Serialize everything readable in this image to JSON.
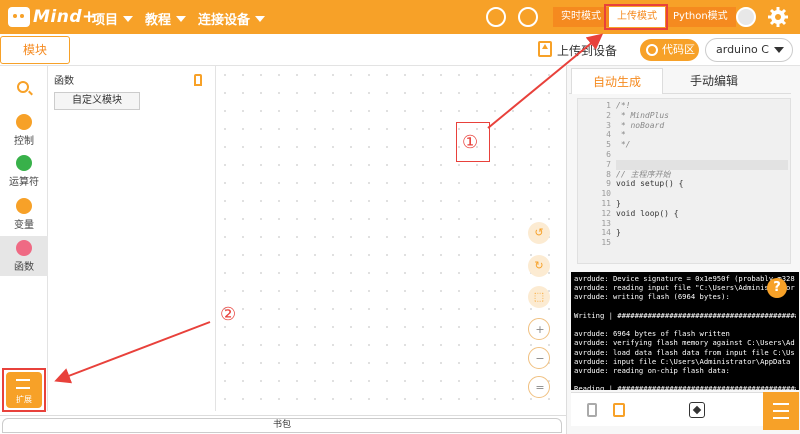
{
  "topbar": {
    "logo_text": "Mind+",
    "menus": [
      {
        "label": "项目"
      },
      {
        "label": "教程"
      },
      {
        "label": "连接设备"
      }
    ],
    "modes": [
      "实时模式",
      "上传模式",
      "Python模式"
    ],
    "active_mode": "上传模式"
  },
  "toolbar": {
    "blocks_tab": "模块",
    "upload_label": "上传到设备",
    "code_area_label": "代码区",
    "board": "arduino C"
  },
  "categories": [
    {
      "label": "控制",
      "color": "#f7a128"
    },
    {
      "label": "运算符",
      "color": "#38b14a"
    },
    {
      "label": "变量",
      "color": "#f7a128"
    },
    {
      "label": "函数",
      "color": "#ef6a84",
      "active": true
    }
  ],
  "extension_label": "扩展",
  "flyout": {
    "title": "函数",
    "custom_block_button": "自定义模块"
  },
  "workspace_controls": [
    "undo-icon",
    "redo-icon",
    "crop-icon",
    "zoom-in-icon",
    "zoom-out-icon",
    "zoom-reset-icon"
  ],
  "annotations": {
    "marker_1": "①",
    "marker_2": "②"
  },
  "bottombar": {
    "bag_label": "书包"
  },
  "code_panel": {
    "tabs": [
      "自动生成",
      "手动编辑"
    ],
    "active_tab": "自动生成",
    "line_numbers": [
      "1",
      "2",
      "3",
      "4",
      "5",
      "6",
      "7",
      "8",
      "9",
      "10",
      "11",
      "12",
      "13",
      "14",
      "15"
    ],
    "code_lines": [
      "/*!",
      " * MindPlus",
      " * noBoard",
      " *",
      " */",
      "",
      "",
      "// 主程序开始",
      "void setup() {",
      "",
      "}",
      "void loop() {",
      "",
      "}",
      ""
    ],
    "console_lines": [
      "avrdude: Device signature = 0x1e950f (probably m328",
      "avrdude: reading input file \"C:\\Users\\Administrator",
      "avrdude: writing flash (6964 bytes):",
      "",
      "Writing | ################################################",
      "",
      "avrdude: 6964 bytes of flash written",
      "avrdude: verifying flash memory against C:\\Users\\Ad",
      "avrdude: load data flash data from input file C:\\Us",
      "avrdude: input file C:\\Users\\Administrator\\AppData",
      "avrdude: reading on-chip flash data:",
      "",
      "Reading | ################################################"
    ],
    "help_label": "?"
  },
  "colors": {
    "accent": "#f7a128",
    "annotation": "#e8413b"
  }
}
